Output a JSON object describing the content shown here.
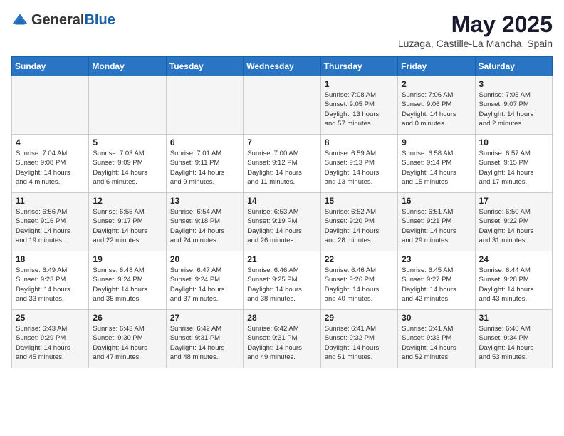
{
  "header": {
    "logo_general": "General",
    "logo_blue": "Blue",
    "month_title": "May 2025",
    "location": "Luzaga, Castille-La Mancha, Spain"
  },
  "weekdays": [
    "Sunday",
    "Monday",
    "Tuesday",
    "Wednesday",
    "Thursday",
    "Friday",
    "Saturday"
  ],
  "weeks": [
    [
      {
        "day": "",
        "info": ""
      },
      {
        "day": "",
        "info": ""
      },
      {
        "day": "",
        "info": ""
      },
      {
        "day": "",
        "info": ""
      },
      {
        "day": "1",
        "info": "Sunrise: 7:08 AM\nSunset: 9:05 PM\nDaylight: 13 hours\nand 57 minutes."
      },
      {
        "day": "2",
        "info": "Sunrise: 7:06 AM\nSunset: 9:06 PM\nDaylight: 14 hours\nand 0 minutes."
      },
      {
        "day": "3",
        "info": "Sunrise: 7:05 AM\nSunset: 9:07 PM\nDaylight: 14 hours\nand 2 minutes."
      }
    ],
    [
      {
        "day": "4",
        "info": "Sunrise: 7:04 AM\nSunset: 9:08 PM\nDaylight: 14 hours\nand 4 minutes."
      },
      {
        "day": "5",
        "info": "Sunrise: 7:03 AM\nSunset: 9:09 PM\nDaylight: 14 hours\nand 6 minutes."
      },
      {
        "day": "6",
        "info": "Sunrise: 7:01 AM\nSunset: 9:11 PM\nDaylight: 14 hours\nand 9 minutes."
      },
      {
        "day": "7",
        "info": "Sunrise: 7:00 AM\nSunset: 9:12 PM\nDaylight: 14 hours\nand 11 minutes."
      },
      {
        "day": "8",
        "info": "Sunrise: 6:59 AM\nSunset: 9:13 PM\nDaylight: 14 hours\nand 13 minutes."
      },
      {
        "day": "9",
        "info": "Sunrise: 6:58 AM\nSunset: 9:14 PM\nDaylight: 14 hours\nand 15 minutes."
      },
      {
        "day": "10",
        "info": "Sunrise: 6:57 AM\nSunset: 9:15 PM\nDaylight: 14 hours\nand 17 minutes."
      }
    ],
    [
      {
        "day": "11",
        "info": "Sunrise: 6:56 AM\nSunset: 9:16 PM\nDaylight: 14 hours\nand 19 minutes."
      },
      {
        "day": "12",
        "info": "Sunrise: 6:55 AM\nSunset: 9:17 PM\nDaylight: 14 hours\nand 22 minutes."
      },
      {
        "day": "13",
        "info": "Sunrise: 6:54 AM\nSunset: 9:18 PM\nDaylight: 14 hours\nand 24 minutes."
      },
      {
        "day": "14",
        "info": "Sunrise: 6:53 AM\nSunset: 9:19 PM\nDaylight: 14 hours\nand 26 minutes."
      },
      {
        "day": "15",
        "info": "Sunrise: 6:52 AM\nSunset: 9:20 PM\nDaylight: 14 hours\nand 28 minutes."
      },
      {
        "day": "16",
        "info": "Sunrise: 6:51 AM\nSunset: 9:21 PM\nDaylight: 14 hours\nand 29 minutes."
      },
      {
        "day": "17",
        "info": "Sunrise: 6:50 AM\nSunset: 9:22 PM\nDaylight: 14 hours\nand 31 minutes."
      }
    ],
    [
      {
        "day": "18",
        "info": "Sunrise: 6:49 AM\nSunset: 9:23 PM\nDaylight: 14 hours\nand 33 minutes."
      },
      {
        "day": "19",
        "info": "Sunrise: 6:48 AM\nSunset: 9:24 PM\nDaylight: 14 hours\nand 35 minutes."
      },
      {
        "day": "20",
        "info": "Sunrise: 6:47 AM\nSunset: 9:24 PM\nDaylight: 14 hours\nand 37 minutes."
      },
      {
        "day": "21",
        "info": "Sunrise: 6:46 AM\nSunset: 9:25 PM\nDaylight: 14 hours\nand 38 minutes."
      },
      {
        "day": "22",
        "info": "Sunrise: 6:46 AM\nSunset: 9:26 PM\nDaylight: 14 hours\nand 40 minutes."
      },
      {
        "day": "23",
        "info": "Sunrise: 6:45 AM\nSunset: 9:27 PM\nDaylight: 14 hours\nand 42 minutes."
      },
      {
        "day": "24",
        "info": "Sunrise: 6:44 AM\nSunset: 9:28 PM\nDaylight: 14 hours\nand 43 minutes."
      }
    ],
    [
      {
        "day": "25",
        "info": "Sunrise: 6:43 AM\nSunset: 9:29 PM\nDaylight: 14 hours\nand 45 minutes."
      },
      {
        "day": "26",
        "info": "Sunrise: 6:43 AM\nSunset: 9:30 PM\nDaylight: 14 hours\nand 47 minutes."
      },
      {
        "day": "27",
        "info": "Sunrise: 6:42 AM\nSunset: 9:31 PM\nDaylight: 14 hours\nand 48 minutes."
      },
      {
        "day": "28",
        "info": "Sunrise: 6:42 AM\nSunset: 9:31 PM\nDaylight: 14 hours\nand 49 minutes."
      },
      {
        "day": "29",
        "info": "Sunrise: 6:41 AM\nSunset: 9:32 PM\nDaylight: 14 hours\nand 51 minutes."
      },
      {
        "day": "30",
        "info": "Sunrise: 6:41 AM\nSunset: 9:33 PM\nDaylight: 14 hours\nand 52 minutes."
      },
      {
        "day": "31",
        "info": "Sunrise: 6:40 AM\nSunset: 9:34 PM\nDaylight: 14 hours\nand 53 minutes."
      }
    ]
  ]
}
